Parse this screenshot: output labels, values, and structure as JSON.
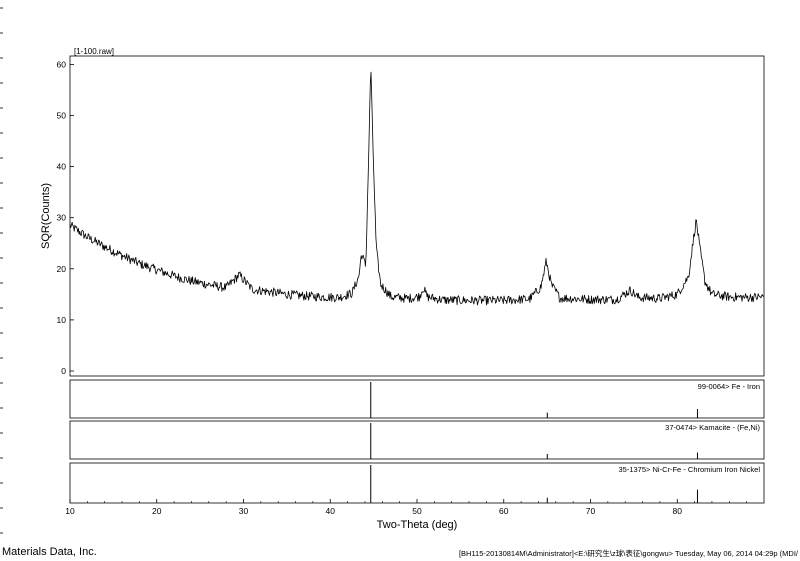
{
  "footer": {
    "vendor": "Materials Data, Inc.",
    "status": "[BH115-20130814M\\Administrator]<E:\\研究生\\z球\\表征\\gongwu> Tuesday, May 06, 2014 04:29p (MDI/"
  },
  "chart_data": {
    "type": "line",
    "title": "[1-100.raw]",
    "xlabel": "Two-Theta (deg)",
    "ylabel": "SQR(Counts)",
    "xlim": [
      10,
      90
    ],
    "ylim": [
      0,
      62
    ],
    "x_ticks": [
      10,
      20,
      30,
      40,
      50,
      60,
      70,
      80
    ],
    "y_ticks": [
      0,
      10,
      20,
      30,
      40,
      50,
      60
    ],
    "series": [
      {
        "x": [
          10,
          12,
          14,
          16,
          18,
          20,
          22,
          24,
          26,
          28,
          29.5,
          31,
          33,
          35,
          37,
          39,
          41,
          42.5,
          43.3,
          43.6,
          44.1,
          44.5,
          44.67,
          44.9,
          45.3,
          45.8,
          47,
          49,
          50.3,
          50.7,
          51.2,
          53,
          56,
          60,
          63,
          64.3,
          64.9,
          65.5,
          66.5,
          70,
          73,
          74.6,
          75.5,
          78,
          80,
          81.3,
          82,
          82.2,
          82.6,
          83.2,
          84,
          86,
          88,
          90
        ],
        "y": [
          28.5,
          26.2,
          24.3,
          22.6,
          21.0,
          19.8,
          18.6,
          17.6,
          16.9,
          16.3,
          18.8,
          16.0,
          15.5,
          15.0,
          14.7,
          14.5,
          14.4,
          15.2,
          18.5,
          23.0,
          20.5,
          47.0,
          60.5,
          45.0,
          24.0,
          17.0,
          14.5,
          14.2,
          14.6,
          16.3,
          14.5,
          13.9,
          13.8,
          13.8,
          14.1,
          16.5,
          21.5,
          16.8,
          14.3,
          14.0,
          14.0,
          15.8,
          14.4,
          14.2,
          15.0,
          18.5,
          27.5,
          29.5,
          24.0,
          17.5,
          15.0,
          14.5,
          14.4,
          14.5
        ]
      }
    ],
    "reference_patterns": [
      {
        "label": "99-0064> Fe - Iron",
        "peaks": [
          {
            "x": 44.67,
            "i": 100
          },
          {
            "x": 65.02,
            "i": 15
          },
          {
            "x": 82.33,
            "i": 25
          }
        ]
      },
      {
        "label": "37-0474> Kamacite - (Fe,Ni)",
        "peaks": [
          {
            "x": 44.67,
            "i": 100
          },
          {
            "x": 65.02,
            "i": 14
          },
          {
            "x": 82.33,
            "i": 18
          }
        ]
      },
      {
        "label": "35-1375> Ni-Cr-Fe - Chromium Iron Nickel",
        "peaks": [
          {
            "x": 44.67,
            "i": 100
          },
          {
            "x": 65.02,
            "i": 14
          },
          {
            "x": 82.33,
            "i": 35
          }
        ]
      }
    ]
  }
}
